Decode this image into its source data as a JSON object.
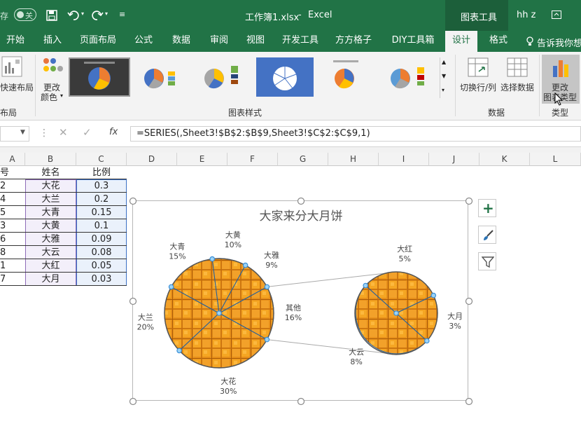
{
  "titlebar": {
    "autosave_label": "存",
    "autosave_state": "关",
    "file_title": "工作簿1.xlsx",
    "app_name": "Excel",
    "separator": "-",
    "context_tools": "图表工具",
    "user": "hh z"
  },
  "tabs": [
    "开始",
    "插入",
    "页面布局",
    "公式",
    "数据",
    "审阅",
    "视图",
    "开发工具",
    "方方格子",
    "DIY工具箱",
    "设计",
    "格式"
  ],
  "tell_me": "告诉我你想",
  "ribbon": {
    "quick_layout": "快速布局",
    "layout_group": "布局",
    "change_colors_line1": "更改",
    "change_colors_line2": "颜色",
    "styles_group": "图表样式",
    "switch_row_col": "切换行/列",
    "select_data": "选择数据",
    "data_group": "数据",
    "change_type_line1": "更改",
    "change_type_line2": "图表类型",
    "type_group": "类型"
  },
  "formula_bar": {
    "formula": "=SERIES(,Sheet3!$B$2:$B$9,Sheet3!$C$2:$C$9,1)"
  },
  "columns": [
    "A",
    "B",
    "C",
    "D",
    "E",
    "F",
    "G",
    "H",
    "I",
    "J",
    "K",
    "L"
  ],
  "table": {
    "headers": [
      "号",
      "姓名",
      "比例"
    ],
    "rows": [
      [
        "2",
        "大花",
        "0.3"
      ],
      [
        "4",
        "大兰",
        "0.2"
      ],
      [
        "5",
        "大青",
        "0.15"
      ],
      [
        "3",
        "大黄",
        "0.1"
      ],
      [
        "6",
        "大雅",
        "0.09"
      ],
      [
        "8",
        "大云",
        "0.08"
      ],
      [
        "1",
        "大红",
        "0.05"
      ],
      [
        "7",
        "大月",
        "0.03"
      ]
    ]
  },
  "chart_data": {
    "type": "pie",
    "subtype": "pie-of-pie",
    "title": "大家来分大月饼",
    "main_pie": [
      {
        "name": "大花",
        "percent": "30%",
        "value": 0.3
      },
      {
        "name": "大兰",
        "percent": "20%",
        "value": 0.2
      },
      {
        "name": "大青",
        "percent": "15%",
        "value": 0.15
      },
      {
        "name": "大黄",
        "percent": "10%",
        "value": 0.1
      },
      {
        "name": "大雅",
        "percent": "9%",
        "value": 0.09
      },
      {
        "name": "其他",
        "percent": "16%",
        "value": 0.16
      }
    ],
    "secondary_pie": [
      {
        "name": "大红",
        "percent": "5%",
        "value": 0.05
      },
      {
        "name": "大月",
        "percent": "3%",
        "value": 0.03
      },
      {
        "name": "大云",
        "percent": "8%",
        "value": 0.08
      }
    ],
    "fill": "waffle texture, orange",
    "colors": {
      "fill": "#e8901a",
      "edge": "#8a4a06",
      "border": "#555555",
      "handle": "#3a8fd8"
    }
  }
}
